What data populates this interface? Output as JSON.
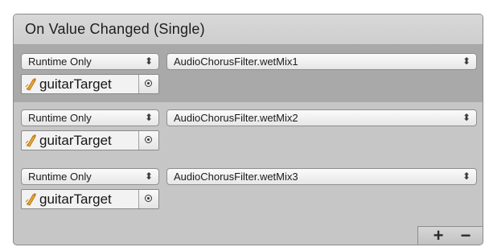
{
  "event": {
    "title": "On Value Changed (Single)"
  },
  "entries": [
    {
      "mode": "Runtime Only",
      "function": "AudioChorusFilter.wetMix1",
      "target": "guitarTarget",
      "target_icon": "audio-source-icon",
      "selected": true
    },
    {
      "mode": "Runtime Only",
      "function": "AudioChorusFilter.wetMix2",
      "target": "guitarTarget",
      "target_icon": "audio-source-icon",
      "selected": false
    },
    {
      "mode": "Runtime Only",
      "function": "AudioChorusFilter.wetMix3",
      "target": "guitarTarget",
      "target_icon": "audio-source-icon",
      "selected": false
    }
  ],
  "controls": {
    "dropdown_arrow": "⬍",
    "add_label": "+",
    "remove_label": "−"
  },
  "colors": {
    "panel_bg": "#c6c6c6",
    "selected_bg": "#a9a9a9",
    "header_bg": "#d4d4d4"
  }
}
